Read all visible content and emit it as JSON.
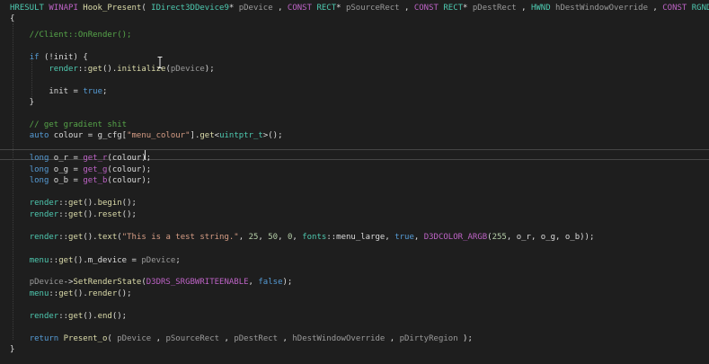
{
  "editor": {
    "lines": [
      {
        "tokens": [
          {
            "t": "HRESULT ",
            "c": "tok-type"
          },
          {
            "t": "WINAPI ",
            "c": "tok-macro"
          },
          {
            "t": "Hook_Present",
            "c": "tok-fn"
          },
          {
            "t": "( ",
            "c": "tok-plain"
          },
          {
            "t": "IDirect3DDevice9",
            "c": "tok-type"
          },
          {
            "t": "* ",
            "c": "tok-plain"
          },
          {
            "t": "pDevice",
            "c": "tok-param"
          },
          {
            "t": " , ",
            "c": "tok-plain"
          },
          {
            "t": "CONST ",
            "c": "tok-macro"
          },
          {
            "t": "RECT",
            "c": "tok-type"
          },
          {
            "t": "* ",
            "c": "tok-plain"
          },
          {
            "t": "pSourceRect",
            "c": "tok-param"
          },
          {
            "t": " , ",
            "c": "tok-plain"
          },
          {
            "t": "CONST ",
            "c": "tok-macro"
          },
          {
            "t": "RECT",
            "c": "tok-type"
          },
          {
            "t": "* ",
            "c": "tok-plain"
          },
          {
            "t": "pDestRect",
            "c": "tok-param"
          },
          {
            "t": " , ",
            "c": "tok-plain"
          },
          {
            "t": "HWND ",
            "c": "tok-type"
          },
          {
            "t": "hDestWindowOverride",
            "c": "tok-param"
          },
          {
            "t": " , ",
            "c": "tok-plain"
          },
          {
            "t": "CONST ",
            "c": "tok-macro"
          },
          {
            "t": "RGNDATA",
            "c": "tok-type"
          },
          {
            "t": "* ",
            "c": "tok-plain"
          }
        ]
      },
      {
        "tokens": [
          {
            "t": "{",
            "c": "tok-plain"
          }
        ]
      },
      {
        "tokens": []
      },
      {
        "tokens": [
          {
            "t": "    //Client::OnRender();",
            "c": "tok-comment"
          }
        ]
      },
      {
        "tokens": []
      },
      {
        "tokens": [
          {
            "t": "    ",
            "c": "tok-plain"
          },
          {
            "t": "if",
            "c": "tok-kw"
          },
          {
            "t": " (!",
            "c": "tok-plain"
          },
          {
            "t": "init",
            "c": "tok-member"
          },
          {
            "t": ") {",
            "c": "tok-plain"
          }
        ]
      },
      {
        "tokens": [
          {
            "t": "        ",
            "c": "tok-plain"
          },
          {
            "t": "render",
            "c": "tok-type"
          },
          {
            "t": "::",
            "c": "tok-plain"
          },
          {
            "t": "get",
            "c": "tok-fn"
          },
          {
            "t": "().",
            "c": "tok-plain"
          },
          {
            "t": "initialize",
            "c": "tok-fn"
          },
          {
            "t": "(",
            "c": "tok-plain"
          },
          {
            "t": "pDevice",
            "c": "tok-param"
          },
          {
            "t": ");",
            "c": "tok-plain"
          }
        ]
      },
      {
        "tokens": []
      },
      {
        "tokens": [
          {
            "t": "        ",
            "c": "tok-plain"
          },
          {
            "t": "init",
            "c": "tok-member"
          },
          {
            "t": " = ",
            "c": "tok-plain"
          },
          {
            "t": "true",
            "c": "tok-kw"
          },
          {
            "t": ";",
            "c": "tok-plain"
          }
        ]
      },
      {
        "tokens": [
          {
            "t": "    }",
            "c": "tok-plain"
          }
        ]
      },
      {
        "tokens": []
      },
      {
        "tokens": [
          {
            "t": "    // get gradient shit",
            "c": "tok-comment"
          }
        ]
      },
      {
        "tokens": [
          {
            "t": "    ",
            "c": "tok-plain"
          },
          {
            "t": "auto",
            "c": "tok-kw"
          },
          {
            "t": " colour = ",
            "c": "tok-plain"
          },
          {
            "t": "g_cfg",
            "c": "tok-member"
          },
          {
            "t": "[",
            "c": "tok-plain"
          },
          {
            "t": "\"menu_colour\"",
            "c": "tok-string"
          },
          {
            "t": "].",
            "c": "tok-plain"
          },
          {
            "t": "get",
            "c": "tok-fn"
          },
          {
            "t": "<",
            "c": "tok-plain"
          },
          {
            "t": "uintptr_t",
            "c": "tok-type"
          },
          {
            "t": ">();",
            "c": "tok-plain"
          }
        ]
      },
      {
        "tokens": []
      },
      {
        "tokens": [
          {
            "t": "    ",
            "c": "tok-plain"
          },
          {
            "t": "long",
            "c": "tok-kw"
          },
          {
            "t": " o_r = ",
            "c": "tok-plain"
          },
          {
            "t": "get_r",
            "c": "tok-macro"
          },
          {
            "t": "(colour);",
            "c": "tok-plain"
          }
        ]
      },
      {
        "tokens": [
          {
            "t": "    ",
            "c": "tok-plain"
          },
          {
            "t": "long",
            "c": "tok-kw"
          },
          {
            "t": " o_g = ",
            "c": "tok-plain"
          },
          {
            "t": "get_g",
            "c": "tok-macro"
          },
          {
            "t": "(colour);",
            "c": "tok-plain"
          }
        ]
      },
      {
        "tokens": [
          {
            "t": "    ",
            "c": "tok-plain"
          },
          {
            "t": "long",
            "c": "tok-kw"
          },
          {
            "t": " o_b = ",
            "c": "tok-plain"
          },
          {
            "t": "get_b",
            "c": "tok-macro"
          },
          {
            "t": "(colour);",
            "c": "tok-plain"
          }
        ]
      },
      {
        "tokens": []
      },
      {
        "tokens": [
          {
            "t": "    ",
            "c": "tok-plain"
          },
          {
            "t": "render",
            "c": "tok-type"
          },
          {
            "t": "::",
            "c": "tok-plain"
          },
          {
            "t": "get",
            "c": "tok-fn"
          },
          {
            "t": "().",
            "c": "tok-plain"
          },
          {
            "t": "begin",
            "c": "tok-fn"
          },
          {
            "t": "();",
            "c": "tok-plain"
          }
        ]
      },
      {
        "tokens": [
          {
            "t": "    ",
            "c": "tok-plain"
          },
          {
            "t": "render",
            "c": "tok-type"
          },
          {
            "t": "::",
            "c": "tok-plain"
          },
          {
            "t": "get",
            "c": "tok-fn"
          },
          {
            "t": "().",
            "c": "tok-plain"
          },
          {
            "t": "reset",
            "c": "tok-fn"
          },
          {
            "t": "();",
            "c": "tok-plain"
          }
        ]
      },
      {
        "tokens": []
      },
      {
        "tokens": [
          {
            "t": "    ",
            "c": "tok-plain"
          },
          {
            "t": "render",
            "c": "tok-type"
          },
          {
            "t": "::",
            "c": "tok-plain"
          },
          {
            "t": "get",
            "c": "tok-fn"
          },
          {
            "t": "().",
            "c": "tok-plain"
          },
          {
            "t": "text",
            "c": "tok-fn"
          },
          {
            "t": "(",
            "c": "tok-plain"
          },
          {
            "t": "\"This is a test string.\"",
            "c": "tok-string"
          },
          {
            "t": ", ",
            "c": "tok-plain"
          },
          {
            "t": "25",
            "c": "tok-num"
          },
          {
            "t": ", ",
            "c": "tok-plain"
          },
          {
            "t": "50",
            "c": "tok-num"
          },
          {
            "t": ", ",
            "c": "tok-plain"
          },
          {
            "t": "0",
            "c": "tok-num"
          },
          {
            "t": ", ",
            "c": "tok-plain"
          },
          {
            "t": "fonts",
            "c": "tok-type"
          },
          {
            "t": "::",
            "c": "tok-plain"
          },
          {
            "t": "menu_large",
            "c": "tok-member"
          },
          {
            "t": ", ",
            "c": "tok-plain"
          },
          {
            "t": "true",
            "c": "tok-kw"
          },
          {
            "t": ", ",
            "c": "tok-plain"
          },
          {
            "t": "D3DCOLOR_ARGB",
            "c": "tok-macro"
          },
          {
            "t": "(",
            "c": "tok-plain"
          },
          {
            "t": "255",
            "c": "tok-num"
          },
          {
            "t": ", o_r, o_g, o_b));",
            "c": "tok-plain"
          }
        ]
      },
      {
        "tokens": []
      },
      {
        "tokens": [
          {
            "t": "    ",
            "c": "tok-plain"
          },
          {
            "t": "menu",
            "c": "tok-type"
          },
          {
            "t": "::",
            "c": "tok-plain"
          },
          {
            "t": "get",
            "c": "tok-fn"
          },
          {
            "t": "().",
            "c": "tok-plain"
          },
          {
            "t": "m_device",
            "c": "tok-member"
          },
          {
            "t": " = ",
            "c": "tok-plain"
          },
          {
            "t": "pDevice",
            "c": "tok-param"
          },
          {
            "t": ";",
            "c": "tok-plain"
          }
        ]
      },
      {
        "tokens": []
      },
      {
        "tokens": [
          {
            "t": "    ",
            "c": "tok-plain"
          },
          {
            "t": "pDevice",
            "c": "tok-param"
          },
          {
            "t": "->",
            "c": "tok-plain"
          },
          {
            "t": "SetRenderState",
            "c": "tok-fn"
          },
          {
            "t": "(",
            "c": "tok-plain"
          },
          {
            "t": "D3DRS_SRGBWRITEENABLE",
            "c": "tok-macro"
          },
          {
            "t": ", ",
            "c": "tok-plain"
          },
          {
            "t": "false",
            "c": "tok-kw"
          },
          {
            "t": ");",
            "c": "tok-plain"
          }
        ]
      },
      {
        "tokens": [
          {
            "t": "    ",
            "c": "tok-plain"
          },
          {
            "t": "menu",
            "c": "tok-type"
          },
          {
            "t": "::",
            "c": "tok-plain"
          },
          {
            "t": "get",
            "c": "tok-fn"
          },
          {
            "t": "().",
            "c": "tok-plain"
          },
          {
            "t": "render",
            "c": "tok-fn"
          },
          {
            "t": "();",
            "c": "tok-plain"
          }
        ]
      },
      {
        "tokens": []
      },
      {
        "tokens": [
          {
            "t": "    ",
            "c": "tok-plain"
          },
          {
            "t": "render",
            "c": "tok-type"
          },
          {
            "t": "::",
            "c": "tok-plain"
          },
          {
            "t": "get",
            "c": "tok-fn"
          },
          {
            "t": "().",
            "c": "tok-plain"
          },
          {
            "t": "end",
            "c": "tok-fn"
          },
          {
            "t": "();",
            "c": "tok-plain"
          }
        ]
      },
      {
        "tokens": []
      },
      {
        "tokens": [
          {
            "t": "    ",
            "c": "tok-plain"
          },
          {
            "t": "return",
            "c": "tok-kw"
          },
          {
            "t": " ",
            "c": "tok-plain"
          },
          {
            "t": "Present_o",
            "c": "tok-fn"
          },
          {
            "t": "( ",
            "c": "tok-plain"
          },
          {
            "t": "pDevice",
            "c": "tok-param"
          },
          {
            "t": " , ",
            "c": "tok-plain"
          },
          {
            "t": "pSourceRect",
            "c": "tok-param"
          },
          {
            "t": " , ",
            "c": "tok-plain"
          },
          {
            "t": "pDestRect",
            "c": "tok-param"
          },
          {
            "t": " , ",
            "c": "tok-plain"
          },
          {
            "t": "hDestWindowOverride",
            "c": "tok-param"
          },
          {
            "t": " , ",
            "c": "tok-plain"
          },
          {
            "t": "pDirtyRegion",
            "c": "tok-param"
          },
          {
            "t": " );",
            "c": "tok-plain"
          }
        ]
      },
      {
        "tokens": [
          {
            "t": "}",
            "c": "tok-plain"
          }
        ]
      }
    ],
    "colors": {
      "background": "#1e1e1e",
      "keyword": "#569cd6",
      "type": "#4ec9b0",
      "macro": "#bd63c5",
      "function": "#dcdcaa",
      "parameter": "#9a9a9a",
      "comment": "#57a64a",
      "string": "#d69d85",
      "number": "#b5cea8"
    }
  }
}
